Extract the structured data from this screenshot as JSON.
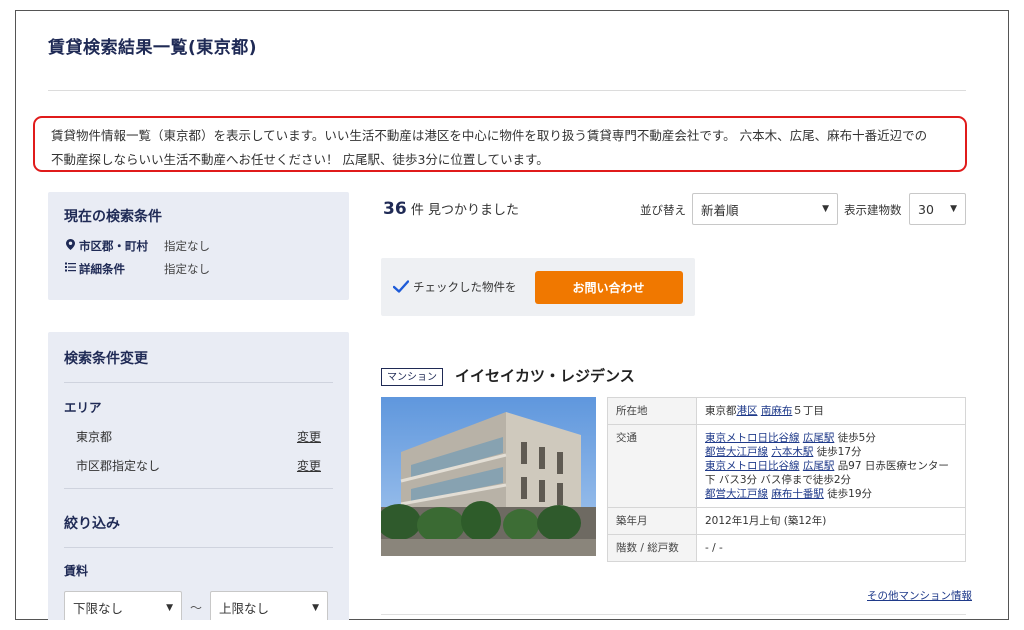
{
  "page": {
    "title": "賃貸検索結果一覧(東京都)"
  },
  "intro": {
    "line1": "賃貸物件情報一覧（東京都）を表示しています。いい生活不動産は港区を中心に物件を取り扱う賃貸専門不動産会社です。 六本木、広尾、麻布十番近辺での",
    "line2": "不動産探しならいい生活不動産へお任せください！ 広尾駅、徒歩3分に位置しています。"
  },
  "current_conditions": {
    "title": "現在の検索条件",
    "rows": [
      {
        "label": "市区郡・町村",
        "value": "指定なし",
        "icon": "map-pin-icon"
      },
      {
        "label": "詳細条件",
        "value": "指定なし",
        "icon": "list-icon"
      }
    ]
  },
  "change_conditions": {
    "title": "検索条件変更",
    "area_heading": "エリア",
    "areas": [
      {
        "name": "東京都",
        "action": "変更"
      },
      {
        "name": "市区郡指定なし",
        "action": "変更"
      }
    ],
    "narrow_title": "絞り込み",
    "rent_heading": "賃料",
    "rent_min": "下限なし",
    "rent_sep": "〜",
    "rent_max": "上限なし"
  },
  "results": {
    "count": "36",
    "count_suffix": "件 見つかりました",
    "sort_label": "並び替え",
    "sort_value": "新着順",
    "display_label": "表示建物数",
    "display_value": "30"
  },
  "check_bar": {
    "text": "チェックした物件を",
    "button": "お問い合わせ"
  },
  "property": {
    "type_tag": "マンション",
    "name": "イイセイカツ・レジデンス",
    "address_label": "所在地",
    "address_prefix": "東京都",
    "address_ward": "港区",
    "address_town": "南麻布",
    "address_rest": "５丁目",
    "transport_label": "交通",
    "transport": [
      {
        "line": "東京メトロ日比谷線",
        "station": "広尾駅",
        "walk": "徒歩5分",
        "extra": ""
      },
      {
        "line": "都営大江戸線",
        "station": "六本木駅",
        "walk": "徒歩17分",
        "extra": ""
      },
      {
        "line": "東京メトロ日比谷線",
        "station": "広尾駅",
        "walk": "",
        "extra": "品97 日赤医療センター下 バス3分 バス停まで徒歩2分"
      },
      {
        "line": "都営大江戸線",
        "station": "麻布十番駅",
        "walk": "徒歩19分",
        "extra": ""
      }
    ],
    "built_label": "築年月",
    "built_value": "2012年1月上旬 (築12年)",
    "floors_label": "階数 / 総戸数",
    "floors_value": "- / -",
    "other_link": "その他マンション情報"
  }
}
